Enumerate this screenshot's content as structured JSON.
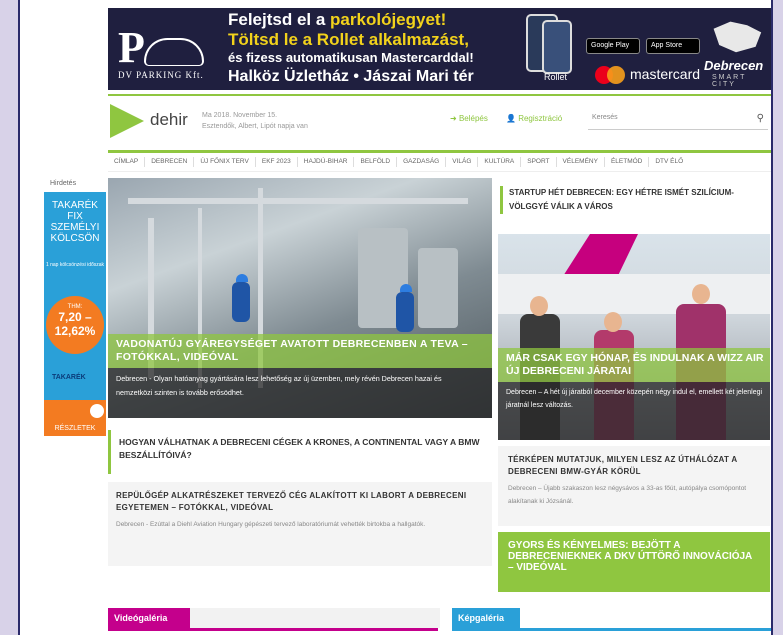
{
  "banner": {
    "line1_a": "Felejtsd el a ",
    "line1_b": "parkolójegyet!",
    "line2": "Töltsd le a Rollet alkalmazást,",
    "line3": "és fizess automatikusan Mastercarddal!",
    "line4": "Halköz Üzletház • Jászai Mari tér",
    "logo_letter": "P",
    "logo_sub": "DV PARKING Kft.",
    "google_play": "Google Play",
    "app_store": "App Store",
    "rollet": "Rollet",
    "mastercard": "mastercard",
    "debrecen": "Debrecen",
    "smart_city": "SMART CITY"
  },
  "header": {
    "logo_text": "dehir",
    "date_line1": "Ma 2018. November 15.",
    "date_line2": "Esztendők, Albert, Lipót napja van",
    "login": "Belépés",
    "register": "Regisztráció",
    "search_placeholder": "Keresés"
  },
  "nav": [
    "CÍMLAP",
    "DEBRECEN",
    "ÚJ FŐNIX TERV",
    "EKF 2023",
    "HAJDÚ-BIHAR",
    "BELFÖLD",
    "GAZDASÁG",
    "VILÁG",
    "KULTÚRA",
    "SPORT",
    "VÉLEMÉNY",
    "ÉLETMÓD",
    "DTV ÉLŐ"
  ],
  "left_ad": {
    "label": "Hirdetés",
    "line1": "TAKARÉK",
    "line2": "FIX",
    "line3": "SZEMÉLYI",
    "line4": "KÖLCSÖN",
    "small": "1 nap\nkölcsönzési\nidőszak",
    "thm": "THM:",
    "v1": "7,20 –",
    "v2": "12,62%",
    "brand": "TAKARÉK",
    "cta": "RÉSZLETEK"
  },
  "main_article": {
    "title": "VADONATÚJ GYÁREGYSÉGET AVATOTT DEBRECENBEN A TEVA – FOTÓKKAL, VIDEÓVAL",
    "desc": "Debrecen - Olyan hatóanyag gyártására lesz lehetőség az új üzemben, mely révén Debrecen hazai és nemzetközi szinten is tovább erősödhet."
  },
  "startup": {
    "title": "STARTUP HÉT DEBRECEN: EGY HÉTRE ISMÉT SZILÍCIUM-VÖLGGYÉ VÁLIK A VÁROS"
  },
  "wizz": {
    "title": "MÁR CSAK EGY HÓNAP, ÉS INDULNAK A WIZZ AIR ÚJ DEBRECENI JÁRATAI",
    "desc": "Debrecen – A hét új járatból december közepén négy indul el, emellett két jelenlegi járatnál lesz változás."
  },
  "hogyan": {
    "title": "HOGYAN VÁLHATNAK A DEBRECENI CÉGEK A KRONES, A CONTINENTAL VAGY A BMW BESZÁLLÍTÓIVÁ?"
  },
  "repulo": {
    "title": "REPÜLŐGÉP ALKATRÉSZEKET TERVEZŐ CÉG ALAKÍTOTT KI LABORT A DEBRECENI EGYETEMEN – FOTÓKKAL, VIDEÓVAL",
    "desc": "Debrecen - Ezúttal a Diehl Aviation Hungary gépészeti tervező laboratóriumát vehették birtokba a hallgatók."
  },
  "terkep": {
    "title": "TÉRKÉPEN MUTATJUK, MILYEN LESZ AZ ÚTHÁLÓZAT A DEBRECENI BMW-GYÁR KÖRÜL",
    "desc": "Debrecen – Újabb szakaszon lesz négysávos a 33-as főút, autópálya csomópontot alakítanak ki Józsánál."
  },
  "gyors": {
    "title": "GYORS ÉS KÉNYELMES: BEJÖTT A DEBRECENIEKNEK A DKV ÚTTÖRŐ INNOVÁCIÓJA – VIDEÓVAL"
  },
  "sections": {
    "video": "Videógaléria",
    "kep": "Képgaléria"
  },
  "colors": {
    "accent": "#8fc640",
    "video": "#c4008c",
    "kep": "#2aa0d8",
    "banner_bg": "#1f1f3f"
  }
}
